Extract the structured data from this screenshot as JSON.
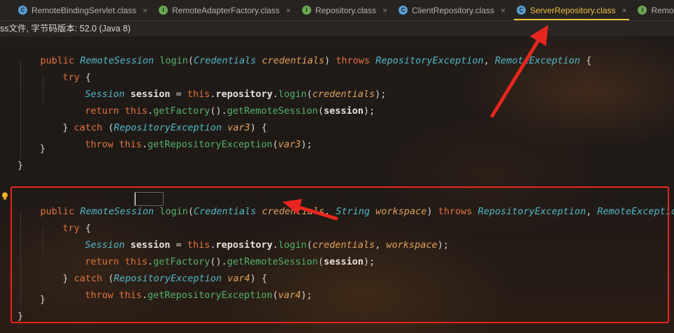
{
  "tabs": [
    {
      "label": "RemoteBindingServlet.class",
      "kind": "C",
      "active": false
    },
    {
      "label": "RemoteAdapterFactory.class",
      "kind": "I",
      "active": false
    },
    {
      "label": "Repository.class",
      "kind": "I",
      "active": false
    },
    {
      "label": "ClientRepository.class",
      "kind": "C",
      "active": false
    },
    {
      "label": "ServerRepository.class",
      "kind": "C",
      "active": true
    },
    {
      "label": "RemoteRe",
      "kind": "I",
      "active": false
    }
  ],
  "tab_close_glyph": "×",
  "infobar": {
    "text": "ss文件, 字节码版本: 52.0 (Java 8)"
  },
  "colors": {
    "keyword": "#e2733d",
    "type": "#4fb8c8",
    "method": "#52b36b",
    "param": "#e2a15b",
    "highlight_box": "#e8261f",
    "active_tab": "#f0c040"
  },
  "icons": {
    "bulb": "lightbulb-icon",
    "tab_class": "class-file-icon",
    "tab_interface": "interface-file-icon"
  },
  "code": {
    "m1": {
      "public": "public",
      "ret": "RemoteSession",
      "name": "login",
      "open": "(",
      "ptype": "Credentials",
      "pname": "credentials",
      "close": ")",
      "throws": "throws",
      "ex1": "RepositoryException",
      "comma": ", ",
      "ex2": "RemoteException",
      "brace": " {"
    },
    "m1_try": "try",
    "m1_s1": {
      "type": "Session",
      "var": "session",
      "eq": " = ",
      "this": "this",
      "dot": ".",
      "field": "repository",
      "method": "login",
      "arg": "credentials"
    },
    "m1_ret": {
      "kw": "return",
      "this": "this",
      "m1": "getFactory",
      "m2": "getRemoteSession",
      "arg": "session"
    },
    "m1_catch": {
      "kw": "catch",
      "type": "RepositoryException",
      "var": "var3"
    },
    "m1_throw": {
      "kw": "throw",
      "this": "this",
      "method": "getRepositoryException",
      "arg": "var3"
    },
    "m2": {
      "public": "public",
      "ret": "RemoteSession",
      "name": "login",
      "ptype": "Credentials",
      "pname": "credentials",
      "ptype2": "String",
      "pname2": "workspace",
      "throws": "throws",
      "ex1": "RepositoryException",
      "ex2": "RemoteException"
    },
    "m2_try": "try",
    "m2_s1": {
      "type": "Session",
      "var": "session",
      "this": "this",
      "field": "repository",
      "method": "login",
      "arg1": "credentials",
      "arg2": "workspace"
    },
    "m2_ret": {
      "kw": "return",
      "this": "this",
      "m1": "getFactory",
      "m2": "getRemoteSession",
      "arg": "session"
    },
    "m2_catch": {
      "kw": "catch",
      "type": "RepositoryException",
      "var": "var4"
    },
    "m2_throw": {
      "kw": "throw",
      "this": "this",
      "method": "getRepositoryException",
      "arg": "var4"
    }
  }
}
